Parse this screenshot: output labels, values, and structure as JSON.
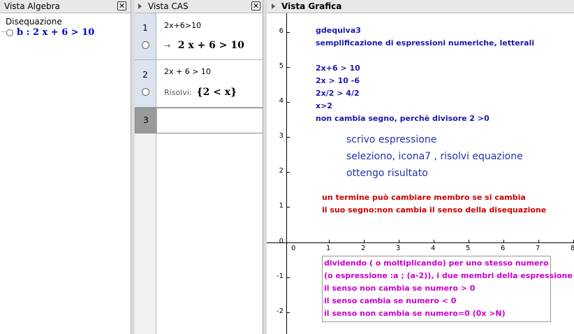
{
  "algebra": {
    "title": "Vista Algebra",
    "category": "Disequazione",
    "item": "b : 2 x + 6 > 10"
  },
  "cas": {
    "title": "Vista CAS",
    "rows": [
      {
        "num": "1",
        "input": "2x+6>10",
        "arrow": "→",
        "output": "2 x + 6 > 10"
      },
      {
        "num": "2",
        "input": "2x + 6 > 10",
        "label": "Risolvi:",
        "output": "{2 < x}"
      },
      {
        "num": "3"
      }
    ]
  },
  "graphics": {
    "title": "Vista Grafica",
    "y_ticks": [
      "6",
      "5",
      "4",
      "3",
      "2",
      "1",
      "0",
      "-1",
      "-2"
    ],
    "x_ticks": [
      "0",
      "1",
      "2",
      "3",
      "4",
      "5",
      "6",
      "7",
      "8"
    ],
    "text_block1": [
      "gdequiva3",
      "semplificazione di espressioni numeriche, letterali",
      "",
      "2x+6 > 10",
      "2x > 10 -6",
      "2x/2 > 4/2",
      "x>2",
      "non cambia segno, perchè divisore 2 >0"
    ],
    "text_block2": [
      "scrivo espressione",
      "seleziono, icona7 , risolvi equazione",
      "ottengo risultato"
    ],
    "text_block3": [
      "un termine può cambiare membro se si cambia",
      "il suo segno:non cambia il senso della disequazione"
    ],
    "text_block4": [
      "dividendo ( o moltiplicando) per uno stesso numero",
      "(o espressione :a ; (a-2)), i due membri della espressione",
      "il senso non cambia se numero > 0",
      "il senso cambia se numero < 0",
      "il senso non cambia se numero=0 (0x >N)"
    ]
  },
  "colors": {
    "header_bg": "#e8e8e8",
    "blue_text": "#1a1aaa",
    "red_text": "#cc0000",
    "pink_text": "#cc00cc"
  }
}
